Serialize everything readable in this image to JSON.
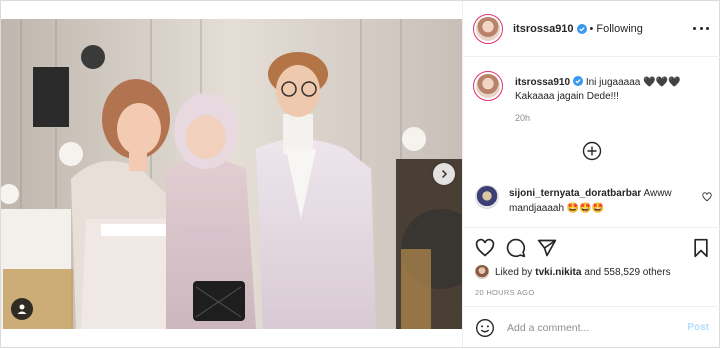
{
  "post": {
    "username": "itsrossa910",
    "follow_status": "Following",
    "separator": "•",
    "caption_line1": "Ini jugaaaaa 🖤🖤🖤",
    "caption_line2": "Kakaaaa jagain Dede!!!",
    "caption_age": "20h",
    "likes_user": "tvki.nikita",
    "likes_and": "Liked by",
    "likes_others": "and 558,529 others",
    "posted_time": "20 HOURS AGO"
  },
  "comments": [
    {
      "username": "sijoni_ternyata_doratbarbar",
      "text": "Awww mandjaaaah 🤩🤩🤩"
    }
  ],
  "add_comment": {
    "placeholder": "Add a comment...",
    "post_label": "Post"
  },
  "icons": {
    "more": "more-options-icon",
    "heart": "heart-icon",
    "comment": "comment-icon",
    "share": "share-icon",
    "save": "bookmark-icon",
    "load_more": "plus-circle-icon",
    "emoji": "smile-icon",
    "user_tag": "user-tag-icon",
    "next": "chevron-right-icon"
  },
  "colors": {
    "verified": "#3897f0",
    "post_button": "#b2dffc",
    "muted": "#8e8e8e"
  }
}
